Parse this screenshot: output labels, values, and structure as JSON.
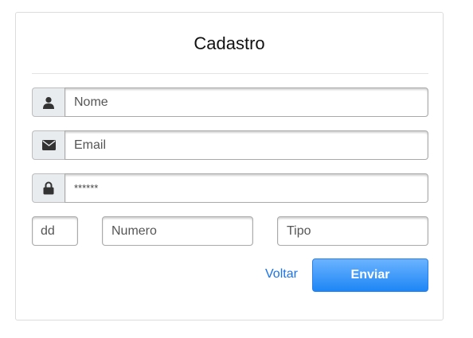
{
  "form": {
    "title": "Cadastro",
    "name_placeholder": "Nome",
    "email_placeholder": "Email",
    "password_value": "******",
    "ddd_placeholder": "dd",
    "number_placeholder": "Numero",
    "type_placeholder": "Tipo",
    "back_label": "Voltar",
    "submit_label": "Enviar"
  },
  "icons": {
    "name": "user-icon",
    "email": "envelope-icon",
    "password": "lock-icon"
  },
  "colors": {
    "accent": "#1d86f5",
    "link": "#1a73e8",
    "addon_bg": "#e9ecef"
  }
}
